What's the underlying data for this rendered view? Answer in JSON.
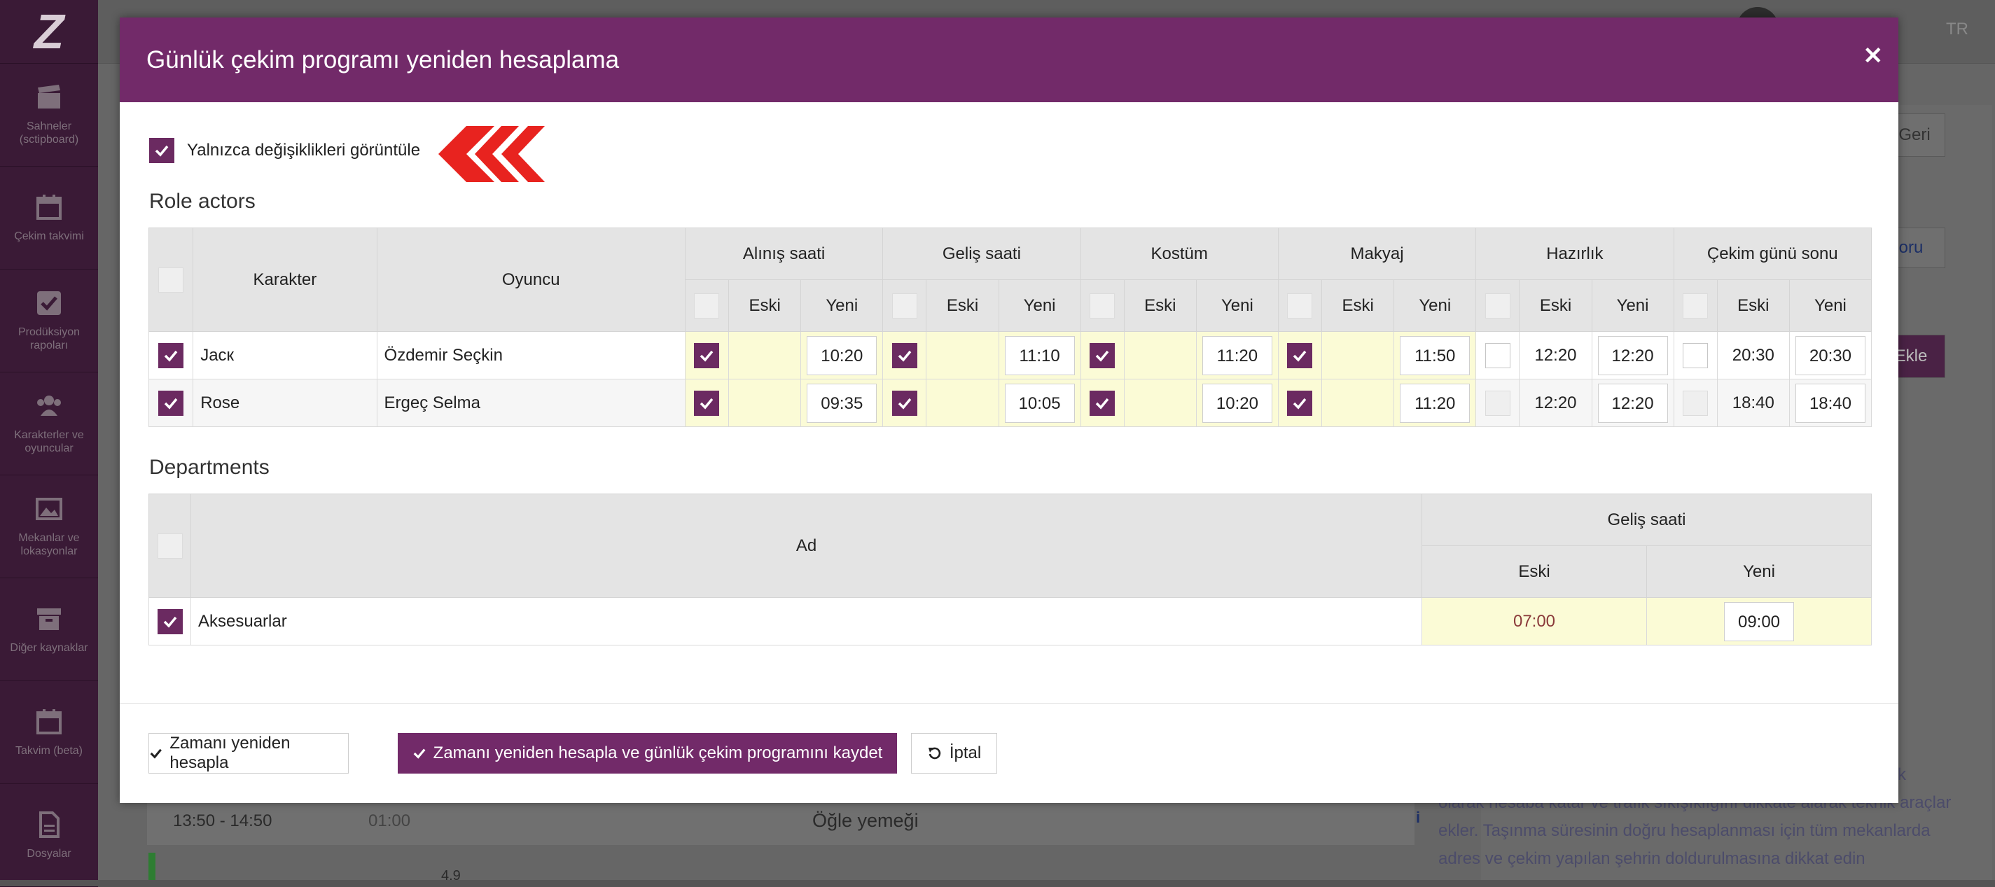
{
  "sidebar": {
    "logo": "Z",
    "items": [
      {
        "label": "Sahneler (sctipboard)",
        "icon": "clapperboard-icon"
      },
      {
        "label": "Çekim takvimi",
        "icon": "calendar-icon"
      },
      {
        "label": "Prodüksiyon rapoları",
        "icon": "check-square-icon"
      },
      {
        "label": "Karakterler ve oyuncular",
        "icon": "users-icon"
      },
      {
        "label": "Mekanlar ve lokasyonlar",
        "icon": "image-icon"
      },
      {
        "label": "Diğer kaynaklar",
        "icon": "archive-icon"
      },
      {
        "label": "Takvim (beta)",
        "icon": "calendar-icon"
      },
      {
        "label": "Dosyalar",
        "icon": "file-icon"
      }
    ]
  },
  "background": {
    "language": "TR",
    "back_button": "Geri",
    "right_button_fragment": "oru",
    "add_button_fragment": "Ekle",
    "lunch_time_range": "13:50 - 14:50",
    "lunch_duration": "01:00",
    "lunch_label": "Öğle yemeği",
    "row_fragment": "4.9",
    "info_lines": [
      "k",
      "olarak hesaba katar ve trafik sıkışıklığını dikkate alarak teknik araçlar",
      "ekler. Taşınma süresinin doğru hesaplanması için tüm mekanlarda",
      "adres ve çekim yapılan şehrin doldurulmasına dikkat edin"
    ]
  },
  "modal": {
    "title": "Günlük çekim programı yeniden hesaplama",
    "only_changes_label": "Yalnızca değişiklikleri görüntüle",
    "only_changes_checked": true,
    "role_actors": {
      "title": "Role actors",
      "col_character": "Karakter",
      "col_actor": "Oyuncu",
      "groups": [
        "Alınış saati",
        "Geliş saati",
        "Kostüm",
        "Makyaj",
        "Hazırlık",
        "Çekim günü sonu"
      ],
      "sub_old": "Eski",
      "sub_new": "Yeni",
      "rows": [
        {
          "checked": true,
          "character": "Jacк",
          "actor": "Özdemir Seçkin",
          "cells": [
            {
              "checked": true,
              "old": "",
              "new": "10:20"
            },
            {
              "checked": true,
              "old": "",
              "new": "11:10"
            },
            {
              "checked": true,
              "old": "",
              "new": "11:20"
            },
            {
              "checked": true,
              "old": "",
              "new": "11:50"
            },
            {
              "checked": false,
              "old": "12:20",
              "new": "12:20"
            },
            {
              "checked": false,
              "old": "20:30",
              "new": "20:30"
            }
          ]
        },
        {
          "checked": true,
          "character": "Rose",
          "actor": "Ergeç Selma",
          "cells": [
            {
              "checked": true,
              "old": "",
              "new": "09:35"
            },
            {
              "checked": true,
              "old": "",
              "new": "10:05"
            },
            {
              "checked": true,
              "old": "",
              "new": "10:20"
            },
            {
              "checked": true,
              "old": "",
              "new": "11:20"
            },
            {
              "checked": false,
              "old": "12:20",
              "new": "12:20"
            },
            {
              "checked": false,
              "old": "18:40",
              "new": "18:40"
            }
          ]
        }
      ]
    },
    "departments": {
      "title": "Departments",
      "col_name": "Ad",
      "group": "Geliş saati",
      "sub_old": "Eski",
      "sub_new": "Yeni",
      "rows": [
        {
          "checked": true,
          "name": "Aksesuarlar",
          "old": "07:00",
          "new": "09:00"
        }
      ]
    },
    "buttons": {
      "recalc": "Zamanı yeniden hesapla",
      "recalc_save": "Zamanı yeniden hesapla ve günlük çekim programını kaydet",
      "cancel": "İptal"
    },
    "colors": {
      "header": "#722a69",
      "checkbox": "#6b2a61",
      "changed_cell": "#fbfbd6",
      "arrow": "#e8231f"
    }
  }
}
